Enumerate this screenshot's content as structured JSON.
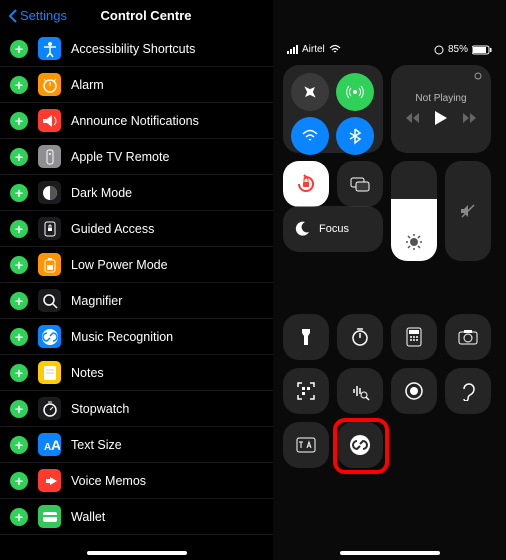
{
  "nav": {
    "back": "Settings",
    "title": "Control Centre"
  },
  "items": [
    {
      "label": "Accessibility Shortcuts",
      "color": "#0a84ff",
      "icon": "accessibility"
    },
    {
      "label": "Alarm",
      "color": "#ff9500",
      "icon": "alarm"
    },
    {
      "label": "Announce Notifications",
      "color": "#ff3b30",
      "icon": "announce"
    },
    {
      "label": "Apple TV Remote",
      "color": "#8e8e93",
      "icon": "remote"
    },
    {
      "label": "Dark Mode",
      "color": "#1c1c1e",
      "icon": "darkmode"
    },
    {
      "label": "Guided Access",
      "color": "#1c1c1e",
      "icon": "guided"
    },
    {
      "label": "Low Power Mode",
      "color": "#ff9500",
      "icon": "lowpower"
    },
    {
      "label": "Magnifier",
      "color": "#1c1c1e",
      "icon": "magnifier"
    },
    {
      "label": "Music Recognition",
      "color": "#0a84ff",
      "icon": "shazam"
    },
    {
      "label": "Notes",
      "color": "#ffcc00",
      "icon": "notes"
    },
    {
      "label": "Stopwatch",
      "color": "#1c1c1e",
      "icon": "stopwatch"
    },
    {
      "label": "Text Size",
      "color": "#0a84ff",
      "icon": "textsize"
    },
    {
      "label": "Voice Memos",
      "color": "#ff3b30",
      "icon": "voicememo"
    },
    {
      "label": "Wallet",
      "color": "#34c759",
      "icon": "wallet"
    }
  ],
  "status": {
    "carrier": "Airtel",
    "battery": "85%"
  },
  "media": {
    "title": "Not Playing"
  },
  "focus": {
    "label": "Focus"
  }
}
